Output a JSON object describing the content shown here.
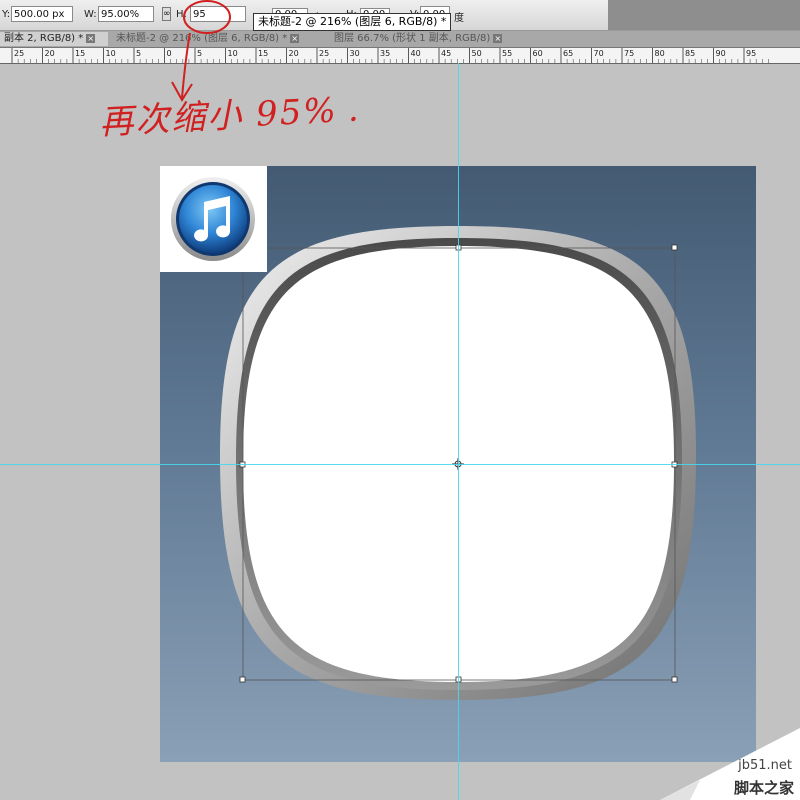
{
  "options_bar": {
    "y_label": "Y:",
    "y_value": "500.00 px",
    "w_label": "W:",
    "w_value": "95.00%",
    "link_icon": "link-icon",
    "h_label": "H:",
    "h_value": "95",
    "angle_value": "0.00",
    "angle_unit": "度",
    "hskew_label": "H:",
    "hskew_value": "0.00",
    "vskew_label": "V:",
    "vskew_value": "0.00",
    "skew_unit": "度"
  },
  "tooltip": "未标题-2 @ 216% (图层 6, RGB/8) *",
  "tabs": [
    {
      "label": "副本 2, RGB/8) *",
      "active": true
    },
    {
      "label": "未标题-2 @ 216% (图层 6, RGB/8) *",
      "active": false
    },
    {
      "label": "图层 66.7% (形状 1 副本, RGB/8)",
      "active": false
    }
  ],
  "ruler": {
    "labels": [
      "25",
      "20",
      "15",
      "10",
      "5",
      "0",
      "5",
      "10",
      "15",
      "20",
      "25",
      "30",
      "35",
      "40",
      "45",
      "50",
      "55",
      "60",
      "65",
      "70",
      "75",
      "80",
      "85",
      "90",
      "95"
    ]
  },
  "annotation": {
    "text": "再次缩小 95%",
    "dot": "."
  },
  "thumbnail": {
    "icon": "itunes-music-note-icon",
    "colors": {
      "outer": "#1a5ea8",
      "inner": "#4aa6e8",
      "note": "#ffffff"
    }
  },
  "watermark": {
    "url": "jb51.net",
    "name": "脚本之家"
  },
  "colors": {
    "canvas_top": "#435a72",
    "canvas_bottom": "#8aa0b6",
    "guide": "#46d8ee",
    "annotation": "#d02020"
  }
}
